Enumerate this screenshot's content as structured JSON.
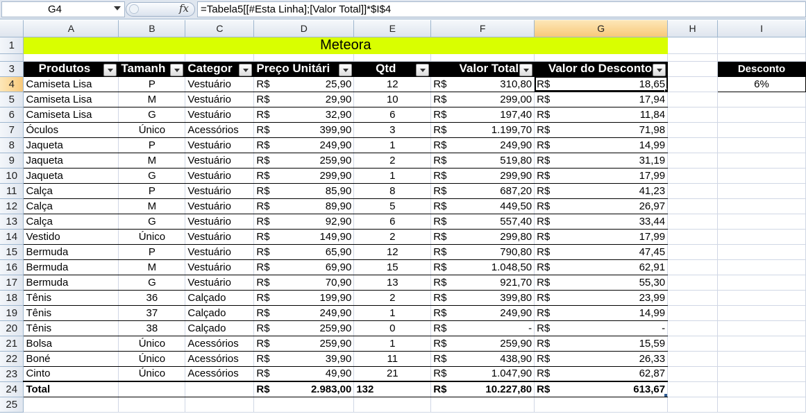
{
  "formula_bar": {
    "cell_reference": "G4",
    "fx_label": "fx",
    "formula": "=Tabela5[[#Esta Linha];[Valor Total]]*$I$4"
  },
  "columns": [
    "A",
    "B",
    "C",
    "D",
    "E",
    "F",
    "G",
    "H",
    "I"
  ],
  "selected_column": "G",
  "selected_row": "4",
  "row_numbers": [
    "1",
    "2",
    "3",
    "4",
    "5",
    "6",
    "7",
    "8",
    "9",
    "10",
    "11",
    "12",
    "13",
    "14",
    "15",
    "16",
    "17",
    "18",
    "19",
    "20",
    "21",
    "22",
    "23",
    "24",
    "25"
  ],
  "title": "Meteora",
  "table_headers": [
    "Produtos",
    "Tamanh",
    "Categor",
    "Preço Unitári",
    "Qtd",
    "Valor Total",
    "Valor do Desconto"
  ],
  "currency": "R$",
  "rows": [
    {
      "produto": "Camiseta Lisa",
      "tamanho": "P",
      "categoria": "Vestuário",
      "preco": "25,90",
      "qtd": "12",
      "total": "310,80",
      "desconto": "18,65"
    },
    {
      "produto": "Camiseta Lisa",
      "tamanho": "M",
      "categoria": "Vestuário",
      "preco": "29,90",
      "qtd": "10",
      "total": "299,00",
      "desconto": "17,94"
    },
    {
      "produto": "Camiseta Lisa",
      "tamanho": "G",
      "categoria": "Vestuário",
      "preco": "32,90",
      "qtd": "6",
      "total": "197,40",
      "desconto": "11,84"
    },
    {
      "produto": "Óculos",
      "tamanho": "Único",
      "categoria": "Acessórios",
      "preco": "399,90",
      "qtd": "3",
      "total": "1.199,70",
      "desconto": "71,98"
    },
    {
      "produto": "Jaqueta",
      "tamanho": "P",
      "categoria": "Vestuário",
      "preco": "249,90",
      "qtd": "1",
      "total": "249,90",
      "desconto": "14,99"
    },
    {
      "produto": "Jaqueta",
      "tamanho": "M",
      "categoria": "Vestuário",
      "preco": "259,90",
      "qtd": "2",
      "total": "519,80",
      "desconto": "31,19"
    },
    {
      "produto": "Jaqueta",
      "tamanho": "G",
      "categoria": "Vestuário",
      "preco": "299,90",
      "qtd": "1",
      "total": "299,90",
      "desconto": "17,99"
    },
    {
      "produto": "Calça",
      "tamanho": "P",
      "categoria": "Vestuário",
      "preco": "85,90",
      "qtd": "8",
      "total": "687,20",
      "desconto": "41,23"
    },
    {
      "produto": "Calça",
      "tamanho": "M",
      "categoria": "Vestuário",
      "preco": "89,90",
      "qtd": "5",
      "total": "449,50",
      "desconto": "26,97"
    },
    {
      "produto": "Calça",
      "tamanho": "G",
      "categoria": "Vestuário",
      "preco": "92,90",
      "qtd": "6",
      "total": "557,40",
      "desconto": "33,44"
    },
    {
      "produto": "Vestido",
      "tamanho": "Único",
      "categoria": "Vestuário",
      "preco": "149,90",
      "qtd": "2",
      "total": "299,80",
      "desconto": "17,99"
    },
    {
      "produto": "Bermuda",
      "tamanho": "P",
      "categoria": "Vestuário",
      "preco": "65,90",
      "qtd": "12",
      "total": "790,80",
      "desconto": "47,45"
    },
    {
      "produto": "Bermuda",
      "tamanho": "M",
      "categoria": "Vestuário",
      "preco": "69,90",
      "qtd": "15",
      "total": "1.048,50",
      "desconto": "62,91"
    },
    {
      "produto": "Bermuda",
      "tamanho": "G",
      "categoria": "Vestuário",
      "preco": "70,90",
      "qtd": "13",
      "total": "921,70",
      "desconto": "55,30"
    },
    {
      "produto": "Tênis",
      "tamanho": "36",
      "categoria": "Calçado",
      "preco": "199,90",
      "qtd": "2",
      "total": "399,80",
      "desconto": "23,99"
    },
    {
      "produto": "Tênis",
      "tamanho": "37",
      "categoria": "Calçado",
      "preco": "249,90",
      "qtd": "1",
      "total": "249,90",
      "desconto": "14,99"
    },
    {
      "produto": "Tênis",
      "tamanho": "38",
      "categoria": "Calçado",
      "preco": "259,90",
      "qtd": "0",
      "total": "-",
      "desconto": "-"
    },
    {
      "produto": "Bolsa",
      "tamanho": "Único",
      "categoria": "Acessórios",
      "preco": "259,90",
      "qtd": "1",
      "total": "259,90",
      "desconto": "15,59"
    },
    {
      "produto": "Boné",
      "tamanho": "Único",
      "categoria": "Acessórios",
      "preco": "39,90",
      "qtd": "11",
      "total": "438,90",
      "desconto": "26,33"
    },
    {
      "produto": "Cinto",
      "tamanho": "Único",
      "categoria": "Acessórios",
      "preco": "49,90",
      "qtd": "21",
      "total": "1.047,90",
      "desconto": "62,87"
    }
  ],
  "total_row": {
    "label": "Total",
    "preco": "2.983,00",
    "qtd": "132",
    "total": "10.227,80",
    "desconto": "613,67"
  },
  "discount_box": {
    "label": "Desconto",
    "value": "6%"
  },
  "colors": {
    "title_fill": "#d9ff00",
    "header_fill": "#000000",
    "header_text": "#ffffff",
    "selection_header": "#f8c97a"
  }
}
